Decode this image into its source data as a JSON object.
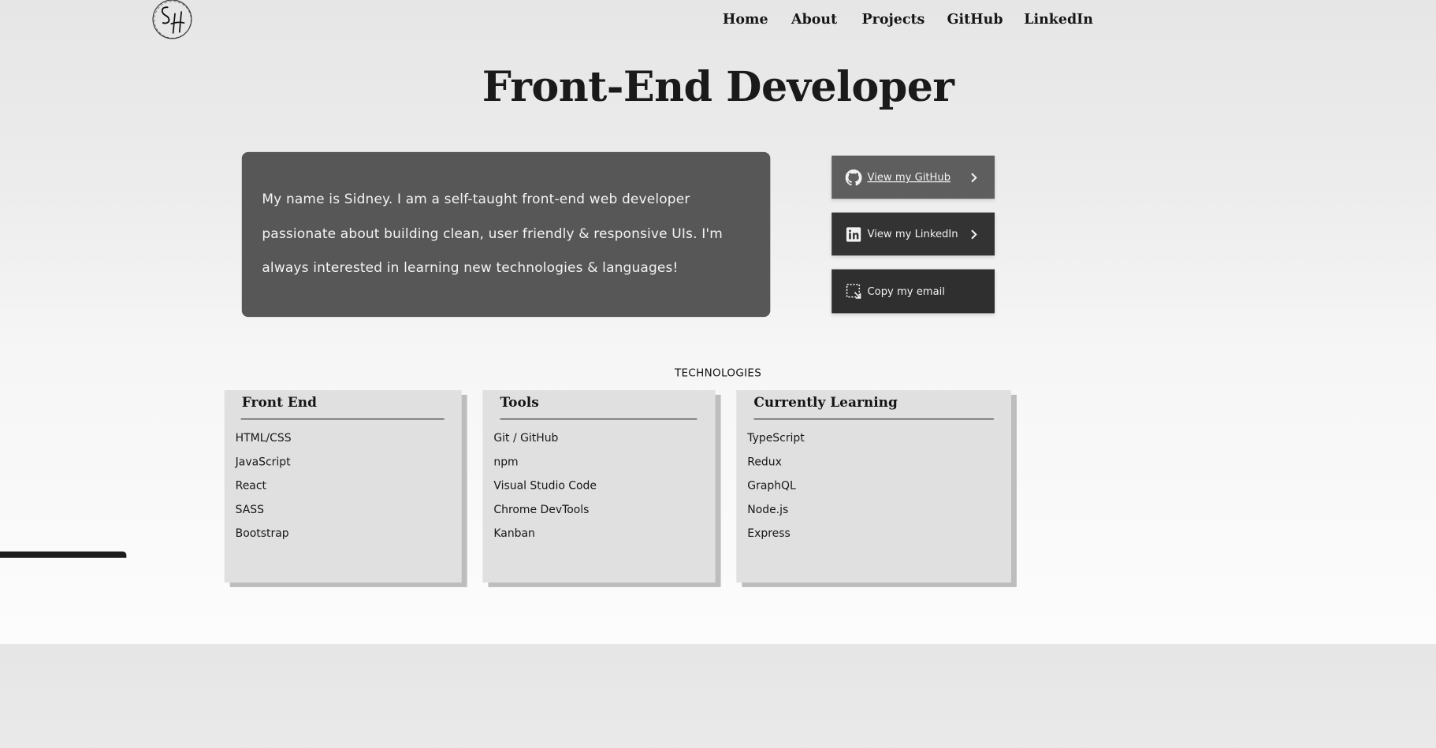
{
  "nav": {
    "logo_text": "SH",
    "links": [
      "Home",
      "About",
      "Projects",
      "GitHub",
      "LinkedIn"
    ]
  },
  "hero": {
    "title": "Front-End Developer",
    "intro": "My name is Sidney. I am a self-taught front-end web developer passionate about building clean, user friendly & responsive UIs. I'm always interested in learning new technologies & languages!"
  },
  "actions": {
    "github": {
      "label": "View my GitHub",
      "icon": "github-icon"
    },
    "linkedin": {
      "label": "View my LinkedIn",
      "icon": "linkedin-icon"
    },
    "email": {
      "label": "Copy my email",
      "icon": "copy-icon"
    }
  },
  "technologies": {
    "heading": "TECHNOLOGIES",
    "cards": [
      {
        "title": "Front End",
        "items": [
          "HTML/CSS",
          "JavaScript",
          "React",
          "SASS",
          "Bootstrap"
        ]
      },
      {
        "title": "Tools",
        "items": [
          "Git / GitHub",
          "npm",
          "Visual Studio Code",
          "Chrome DevTools",
          "Kanban"
        ]
      },
      {
        "title": "Currently Learning",
        "items": [
          "TypeScript",
          "Redux",
          "GraphQL",
          "Node.js",
          "Express"
        ]
      }
    ]
  },
  "colors": {
    "intro_card": "#575757",
    "github_button": "#5e5e5e",
    "linkedin_button": "#333333",
    "email_button": "#2f2f2f",
    "tech_card": "#e0e0e0"
  }
}
